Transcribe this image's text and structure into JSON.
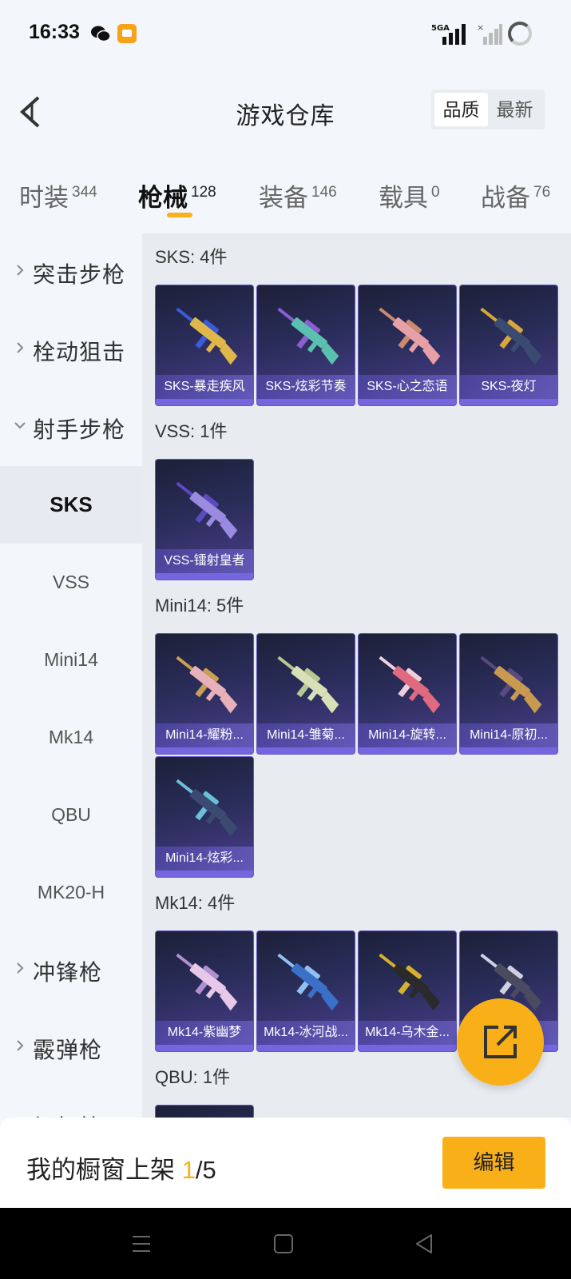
{
  "status_bar": {
    "time": "16:33",
    "network": "5GA"
  },
  "header": {
    "title": "游戏仓库",
    "sort_options": [
      "品质",
      "最新"
    ],
    "selected_sort": "品质"
  },
  "tabs": [
    {
      "label": "时装",
      "count": "344"
    },
    {
      "label": "枪械",
      "count": "128"
    },
    {
      "label": "装备",
      "count": "146"
    },
    {
      "label": "载具",
      "count": "0"
    },
    {
      "label": "战备",
      "count": "76"
    }
  ],
  "active_tab": "枪械",
  "sidebar": {
    "groups": [
      "突击步枪",
      "栓动狙击",
      "射手步枪",
      "冲锋枪",
      "霰弹枪",
      "轻机枪"
    ],
    "subitems": [
      "SKS",
      "VSS",
      "Mini14",
      "Mk14",
      "QBU",
      "MK20-H"
    ],
    "active_subitem": "SKS"
  },
  "sections": [
    {
      "title": "SKS: 4件",
      "items": [
        "SKS-暴走疾风",
        "SKS-炫彩节奏",
        "SKS-心之恋语",
        "SKS-夜灯"
      ]
    },
    {
      "title": "VSS: 1件",
      "items": [
        "VSS-镭射皇者"
      ]
    },
    {
      "title": "Mini14: 5件",
      "items": [
        "Mini14-耀粉...",
        "Mini14-雏菊...",
        "Mini14-旋转...",
        "Mini14-原初...",
        "Mini14-炫彩..."
      ]
    },
    {
      "title": "Mk14: 4件",
      "items": [
        "Mk14-紫幽梦",
        "Mk14-冰河战...",
        "Mk14-乌木金...",
        "Mk14-..."
      ]
    },
    {
      "title": "QBU: 1件",
      "items": [
        ""
      ]
    }
  ],
  "bottom_bar": {
    "label": "我的橱窗上架",
    "current": "1",
    "total": "/5",
    "edit_button": "编辑"
  },
  "colors": {
    "accent": "#f9b018",
    "card_purple": "#4b3f8e"
  }
}
